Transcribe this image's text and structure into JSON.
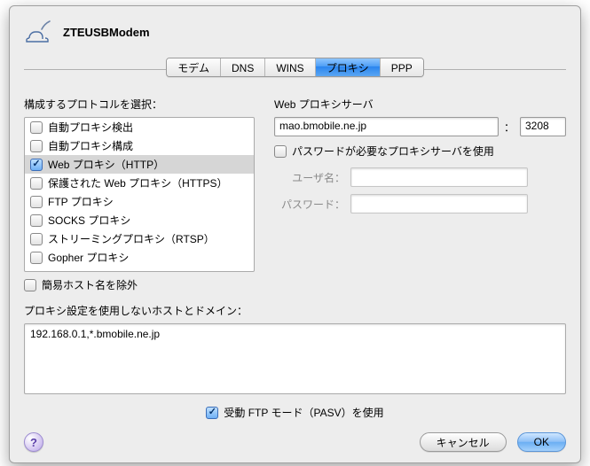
{
  "header": {
    "title": "ZTEUSBModem"
  },
  "tabs": [
    "モデム",
    "DNS",
    "WINS",
    "プロキシ",
    "PPP"
  ],
  "left": {
    "label": "構成するプロトコルを選択：",
    "items": [
      {
        "label": "自動プロキシ検出",
        "checked": false
      },
      {
        "label": "自動プロキシ構成",
        "checked": false
      },
      {
        "label": "Web プロキシ（HTTP）",
        "checked": true
      },
      {
        "label": "保護された Web プロキシ（HTTPS）",
        "checked": false
      },
      {
        "label": "FTP プロキシ",
        "checked": false
      },
      {
        "label": "SOCKS プロキシ",
        "checked": false
      },
      {
        "label": "ストリーミングプロキシ（RTSP）",
        "checked": false
      },
      {
        "label": "Gopher プロキシ",
        "checked": false
      }
    ],
    "simple_host_label": "簡易ホスト名を除外"
  },
  "right": {
    "server_label": "Web プロキシサーバ",
    "host": "mao.bmobile.ne.jp",
    "colon": "：",
    "port": "3208",
    "auth_label": "パスワードが必要なプロキシサーバを使用",
    "user_label": "ユーザ名：",
    "pass_label": "パスワード："
  },
  "bypass": {
    "label": "プロキシ設定を使用しないホストとドメイン：",
    "value": "192.168.0.1,*.bmobile.ne.jp"
  },
  "pasv": {
    "label": "受動 FTP モード（PASV）を使用"
  },
  "footer": {
    "cancel": "キャンセル",
    "ok": "OK",
    "help": "?"
  }
}
